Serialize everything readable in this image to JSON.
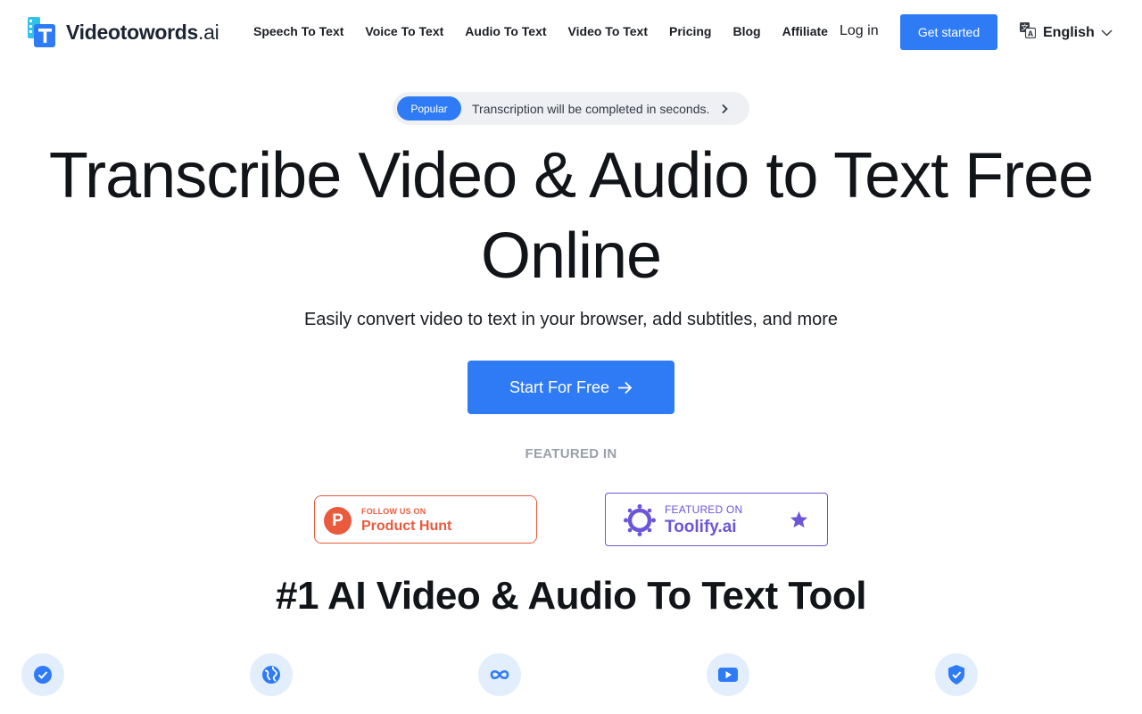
{
  "header": {
    "logo": {
      "name": "Videotowords",
      "suffix": ".ai"
    },
    "nav": [
      {
        "label": "Speech To Text"
      },
      {
        "label": "Voice To Text"
      },
      {
        "label": "Audio To Text"
      },
      {
        "label": "Video To Text"
      },
      {
        "label": "Pricing"
      },
      {
        "label": "Blog"
      },
      {
        "label": "Affiliate"
      }
    ],
    "login_label": "Log in",
    "get_started_label": "Get started",
    "language": "English"
  },
  "announcement": {
    "badge": "Popular",
    "text": "Transcription will be completed in seconds."
  },
  "hero": {
    "title": "Transcribe Video & Audio to Text Free Online",
    "subtitle": "Easily convert video to text in your browser, add subtitles, and more",
    "cta_label": "Start For Free"
  },
  "featured": {
    "label": "FEATURED IN",
    "product_hunt": {
      "small": "FOLLOW US ON",
      "big": "Product Hunt",
      "letter": "P"
    },
    "toolify": {
      "small": "FEATURED ON",
      "big": "Toolify.ai"
    }
  },
  "section": {
    "title": "#1 AI Video & Audio To Text Tool",
    "feature_icons": [
      "check-badge-icon",
      "globe-icon",
      "infinity-icon",
      "play-icon",
      "shield-check-icon"
    ]
  },
  "colors": {
    "accent": "#2f7bf5",
    "product_hunt": "#ea5a3d",
    "toolify": "#6c56d8",
    "icon_bg": "#e3eefc"
  }
}
